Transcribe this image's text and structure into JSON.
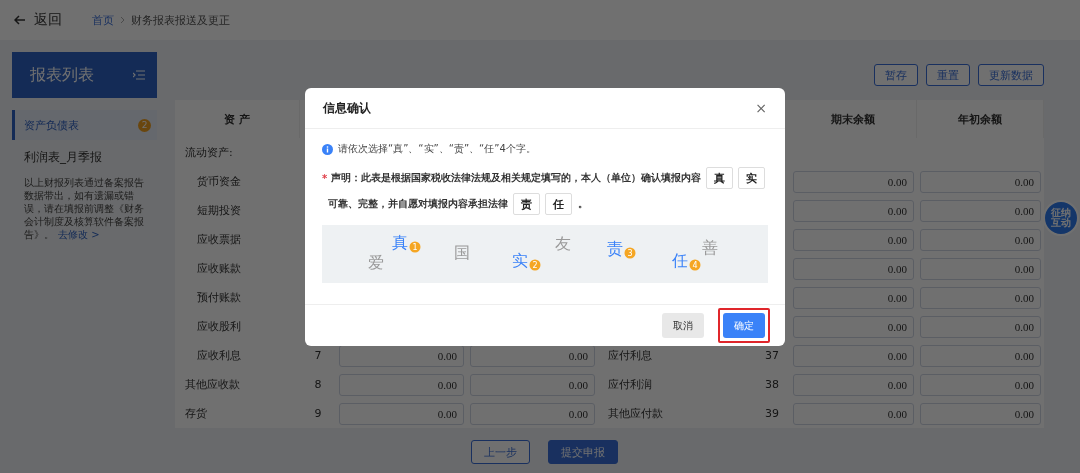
{
  "header": {
    "back": "返回",
    "breadcrumb": [
      {
        "label": "首页",
        "link": true
      },
      {
        "label": "财务报表报送及更正",
        "link": false
      }
    ]
  },
  "sidebar": {
    "title": "报表列表",
    "items": [
      {
        "label": "资产负债表",
        "selected": true,
        "badge": "2"
      },
      {
        "label": "利润表_月季报",
        "selected": false
      }
    ],
    "note": {
      "text": "以上财报列表通过备案报告数据带出，如有遗漏或错误，请在填报前调整《财务会计制度及核算软件备案报告》。",
      "link": "去修改 >"
    }
  },
  "toolbar": [
    "暂存",
    "重置",
    "更新数据"
  ],
  "table": {
    "asset_header": "资 产",
    "liability_headers": [
      "期末余额",
      "年初余额"
    ],
    "rows": [
      {
        "asset": {
          "label": "流动资产:",
          "indented": false
        },
        "liability": {}
      },
      {
        "asset": {
          "label": "货币资金",
          "indented": true
        },
        "liability": {
          "end": "0.00",
          "begin": "0.00"
        }
      },
      {
        "asset": {
          "label": "短期投资",
          "indented": true
        },
        "liability": {
          "end": "0.00",
          "begin": "0.00"
        }
      },
      {
        "asset": {
          "label": "应收票据",
          "indented": true
        },
        "liability": {
          "end": "0.00",
          "begin": "0.00"
        }
      },
      {
        "asset": {
          "label": "应收账款",
          "indented": true
        },
        "liability": {
          "end": "0.00",
          "begin": "0.00"
        }
      },
      {
        "asset": {
          "label": "预付账款",
          "indented": true
        },
        "liability": {
          "end": "0.00",
          "begin": "0.00"
        }
      },
      {
        "asset": {
          "label": "应收股利",
          "indented": true
        },
        "liability": {
          "end": "0.00",
          "begin": "0.00"
        }
      },
      {
        "asset": {
          "label": "应收利息",
          "indented": true,
          "line": "7",
          "end": "0.00",
          "begin": "0.00"
        },
        "liability": {
          "label": "应付利息",
          "line": "37",
          "end": "0.00",
          "begin": "0.00"
        }
      },
      {
        "asset": {
          "label": "其他应收款",
          "indented": false,
          "line": "8",
          "end": "0.00",
          "begin": "0.00"
        },
        "liability": {
          "label": "应付利润",
          "line": "38",
          "end": "0.00",
          "begin": "0.00"
        }
      },
      {
        "asset": {
          "label": "存货",
          "indented": false,
          "line": "9",
          "end": "0.00",
          "begin": "0.00"
        },
        "liability": {
          "label": "其他应付款",
          "line": "39",
          "end": "0.00",
          "begin": "0.00"
        }
      }
    ]
  },
  "footer_buttons": [
    {
      "label": "上一步",
      "primary": false
    },
    {
      "label": "提交申报",
      "primary": true
    }
  ],
  "assistant": {
    "label": "征纳互动"
  },
  "dialog": {
    "title": "信息确认",
    "close": "×",
    "info": "请依次选择“真”、“实”、“责”、“任”4个字。",
    "statement": {
      "required_mark": "*",
      "line1": "声明：此表是根据国家税收法律法规及相关规定填写的，本人（单位）确认填报内容",
      "boxes1": [
        "真",
        "实"
      ],
      "line2": "可靠、完整，并自愿对填报内容承担法律",
      "boxes2": [
        "责",
        "任"
      ],
      "end": "。"
    },
    "captcha": [
      {
        "char": "真",
        "selected": true,
        "order": "1"
      },
      {
        "char": "爱",
        "selected": false
      },
      {
        "char": "国",
        "selected": false
      },
      {
        "char": "实",
        "selected": true,
        "order": "2"
      },
      {
        "char": "友",
        "selected": false
      },
      {
        "char": "责",
        "selected": true,
        "order": "3"
      },
      {
        "char": "任",
        "selected": true,
        "order": "4"
      },
      {
        "char": "善",
        "selected": false
      }
    ],
    "buttons": [
      {
        "label": "取消",
        "primary": false,
        "highlighted": false
      },
      {
        "label": "确定",
        "primary": true,
        "highlighted": true
      }
    ]
  }
}
